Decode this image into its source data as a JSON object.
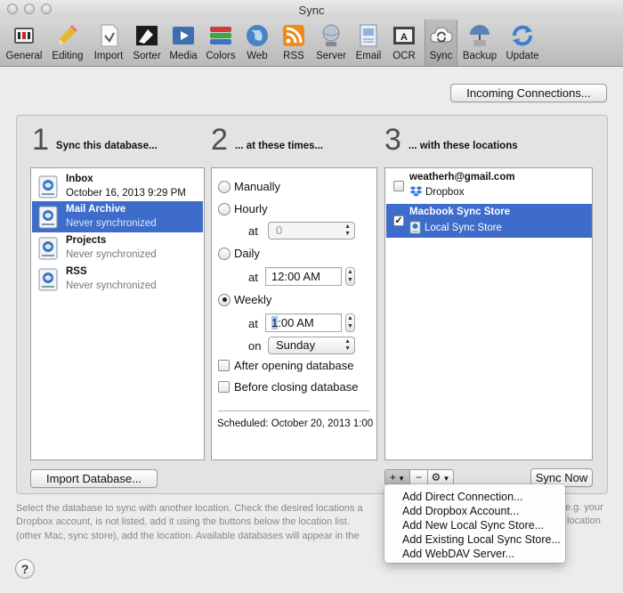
{
  "window": {
    "title": "Sync"
  },
  "toolbar": {
    "items": [
      {
        "label": "General",
        "icon": "general-icon"
      },
      {
        "label": "Editing",
        "icon": "pencil-icon"
      },
      {
        "label": "Import",
        "icon": "import-icon"
      },
      {
        "label": "Sorter",
        "icon": "sorter-icon"
      },
      {
        "label": "Media",
        "icon": "media-icon"
      },
      {
        "label": "Colors",
        "icon": "colors-icon"
      },
      {
        "label": "Web",
        "icon": "globe-icon"
      },
      {
        "label": "RSS",
        "icon": "rss-icon"
      },
      {
        "label": "Server",
        "icon": "server-icon"
      },
      {
        "label": "Email",
        "icon": "email-icon"
      },
      {
        "label": "OCR",
        "icon": "ocr-icon"
      },
      {
        "label": "Sync",
        "icon": "sync-icon"
      },
      {
        "label": "Backup",
        "icon": "backup-icon"
      },
      {
        "label": "Update",
        "icon": "update-icon"
      }
    ],
    "active": "Sync"
  },
  "incoming_button": "Incoming Connections...",
  "sections": {
    "one": {
      "num": "1",
      "title": "Sync this database..."
    },
    "two": {
      "num": "2",
      "title": "... at these times..."
    },
    "three": {
      "num": "3",
      "title": "... with these locations"
    }
  },
  "databases": [
    {
      "name": "Inbox",
      "status": "October 16, 2013 9:29 PM",
      "selected": false
    },
    {
      "name": "Mail Archive",
      "status": "Never synchronized",
      "selected": true
    },
    {
      "name": "Projects",
      "status": "Never synchronized",
      "selected": false
    },
    {
      "name": "RSS",
      "status": "Never synchronized",
      "selected": false
    }
  ],
  "schedule": {
    "manually": "Manually",
    "hourly": "Hourly",
    "at_label": "at",
    "hourly_value": "0",
    "daily": "Daily",
    "daily_time": "12:00 AM",
    "weekly": "Weekly",
    "weekly_time_hour": "1",
    "weekly_time_rest": ":00 AM",
    "on_label": "on",
    "weekly_day": "Sunday",
    "after_opening": "After opening database",
    "before_closing": "Before closing database",
    "selected": "Weekly",
    "scheduled_text": "Scheduled: October 20, 2013 1:00"
  },
  "locations": [
    {
      "name": "weatherh@gmail.com",
      "type": "Dropbox",
      "checked": false,
      "selected": false,
      "icon": "dropbox-icon"
    },
    {
      "name": "Macbook Sync Store",
      "type": "Local Sync Store",
      "checked": true,
      "selected": true,
      "icon": "local-store-icon"
    }
  ],
  "buttons": {
    "import_database": "Import Database...",
    "sync_now": "Sync Now",
    "add": "+",
    "remove": "−",
    "action": "⚙"
  },
  "add_menu": [
    "Add Direct Connection...",
    "Add Dropbox Account...",
    "Add New Local Sync Store...",
    "Add Existing Local Sync Store...",
    "Add WebDAV Server..."
  ],
  "hint_lines": [
    "Select the database to sync with another location. Check the desired locations a",
    "Dropbox account, is not listed, add it using the buttons below the location list.",
    "(other Mac, sync store), add the location. Available databases will appear in the"
  ],
  "hint_right": [
    "e.g. your",
    "location"
  ],
  "help": "?"
}
